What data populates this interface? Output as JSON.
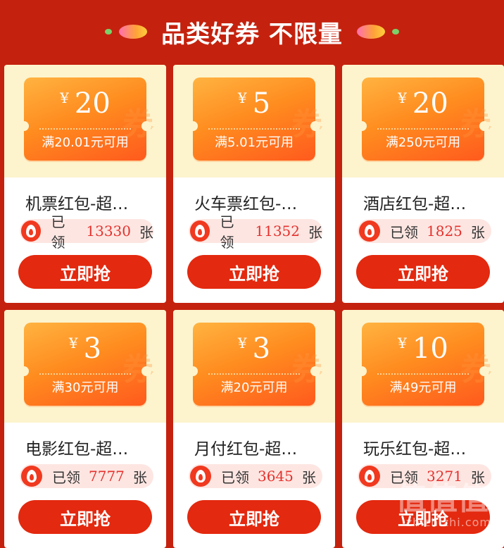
{
  "header": {
    "title": "品类好券 不限量"
  },
  "cards": [
    {
      "yen": "¥",
      "amount": "20",
      "condition": "满20.01元可用",
      "name": "机票红包-超…",
      "claimed_prefix": "已领",
      "claimed_count": "13330",
      "claimed_unit": "张",
      "button": "立即抢",
      "watermark": "券"
    },
    {
      "yen": "¥",
      "amount": "5",
      "condition": "满5.01元可用",
      "name": "火车票红包-…",
      "claimed_prefix": "已领",
      "claimed_count": "11352",
      "claimed_unit": "张",
      "button": "立即抢",
      "watermark": "券"
    },
    {
      "yen": "¥",
      "amount": "20",
      "condition": "满250元可用",
      "name": "酒店红包-超…",
      "claimed_prefix": "已领",
      "claimed_count": "1825",
      "claimed_unit": "张",
      "button": "立即抢",
      "watermark": "券"
    },
    {
      "yen": "¥",
      "amount": "3",
      "condition": "满30元可用",
      "name": "电影红包-超…",
      "claimed_prefix": "已领",
      "claimed_count": "7777",
      "claimed_unit": "张",
      "button": "立即抢",
      "watermark": "券"
    },
    {
      "yen": "¥",
      "amount": "3",
      "condition": "满20元可用",
      "name": "月付红包-超…",
      "claimed_prefix": "已领",
      "claimed_count": "3645",
      "claimed_unit": "张",
      "button": "立即抢",
      "watermark": "券"
    },
    {
      "yen": "¥",
      "amount": "10",
      "condition": "满49元可用",
      "name": "玩乐红包-超…",
      "claimed_prefix": "已领",
      "claimed_count": "3271",
      "claimed_unit": "张",
      "button": "立即抢",
      "watermark": "券"
    }
  ],
  "site_watermark": {
    "big": "值值值",
    "small": "zhizhizhi.com"
  },
  "colors": {
    "background": "#c4220e",
    "button": "#e3290f",
    "ticket_start": "#ffb341",
    "ticket_end": "#ff5a1d",
    "card_top": "#fdf4cd",
    "count": "#e5302c"
  }
}
